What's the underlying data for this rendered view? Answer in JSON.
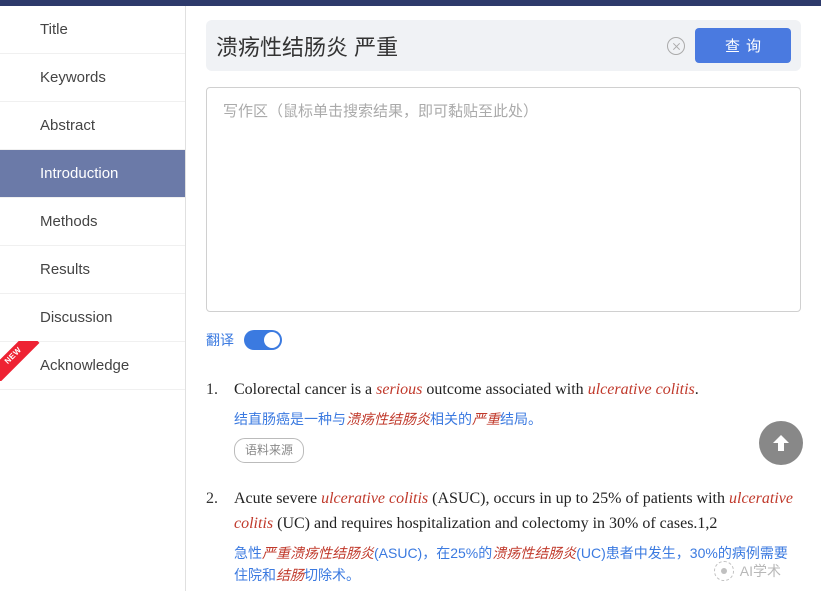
{
  "sidebar": {
    "items": [
      {
        "label": "Title"
      },
      {
        "label": "Keywords"
      },
      {
        "label": "Abstract"
      },
      {
        "label": "Introduction",
        "active": true
      },
      {
        "label": "Methods"
      },
      {
        "label": "Results"
      },
      {
        "label": "Discussion"
      },
      {
        "label": "Acknowledge",
        "badge": "NEW"
      }
    ]
  },
  "search": {
    "value": "溃疡性结肠炎 严重",
    "button_label": "查询"
  },
  "writing_area": {
    "placeholder": "写作区（鼠标单击搜索结果，即可黏贴至此处）"
  },
  "translate": {
    "label": "翻译",
    "on": true
  },
  "results": [
    {
      "num": "1.",
      "en_html": "Colorectal cancer is a <em>serious</em> outcome associated with <em>ulcerative colitis</em>.",
      "zh_html": "结直肠癌是一种与<em>溃疡性结肠炎</em>相关的<em>严重</em>结局。",
      "source_label": "语料来源"
    },
    {
      "num": "2.",
      "en_html": "Acute severe <em>ulcerative colitis</em> (ASUC), occurs in up to 25% of patients with <em>ulcerative colitis</em> (UC) and requires hospitalization and colectomy in 30% of cases.1,2",
      "zh_html": "急性<em>严重溃疡性结肠炎</em>(ASUC)，在25%的<em>溃疡性结肠炎</em>(UC)患者中发生，30%的病例需要住院和<em>结肠</em>切除术。"
    }
  ],
  "watermark": {
    "text": "AI学术"
  }
}
